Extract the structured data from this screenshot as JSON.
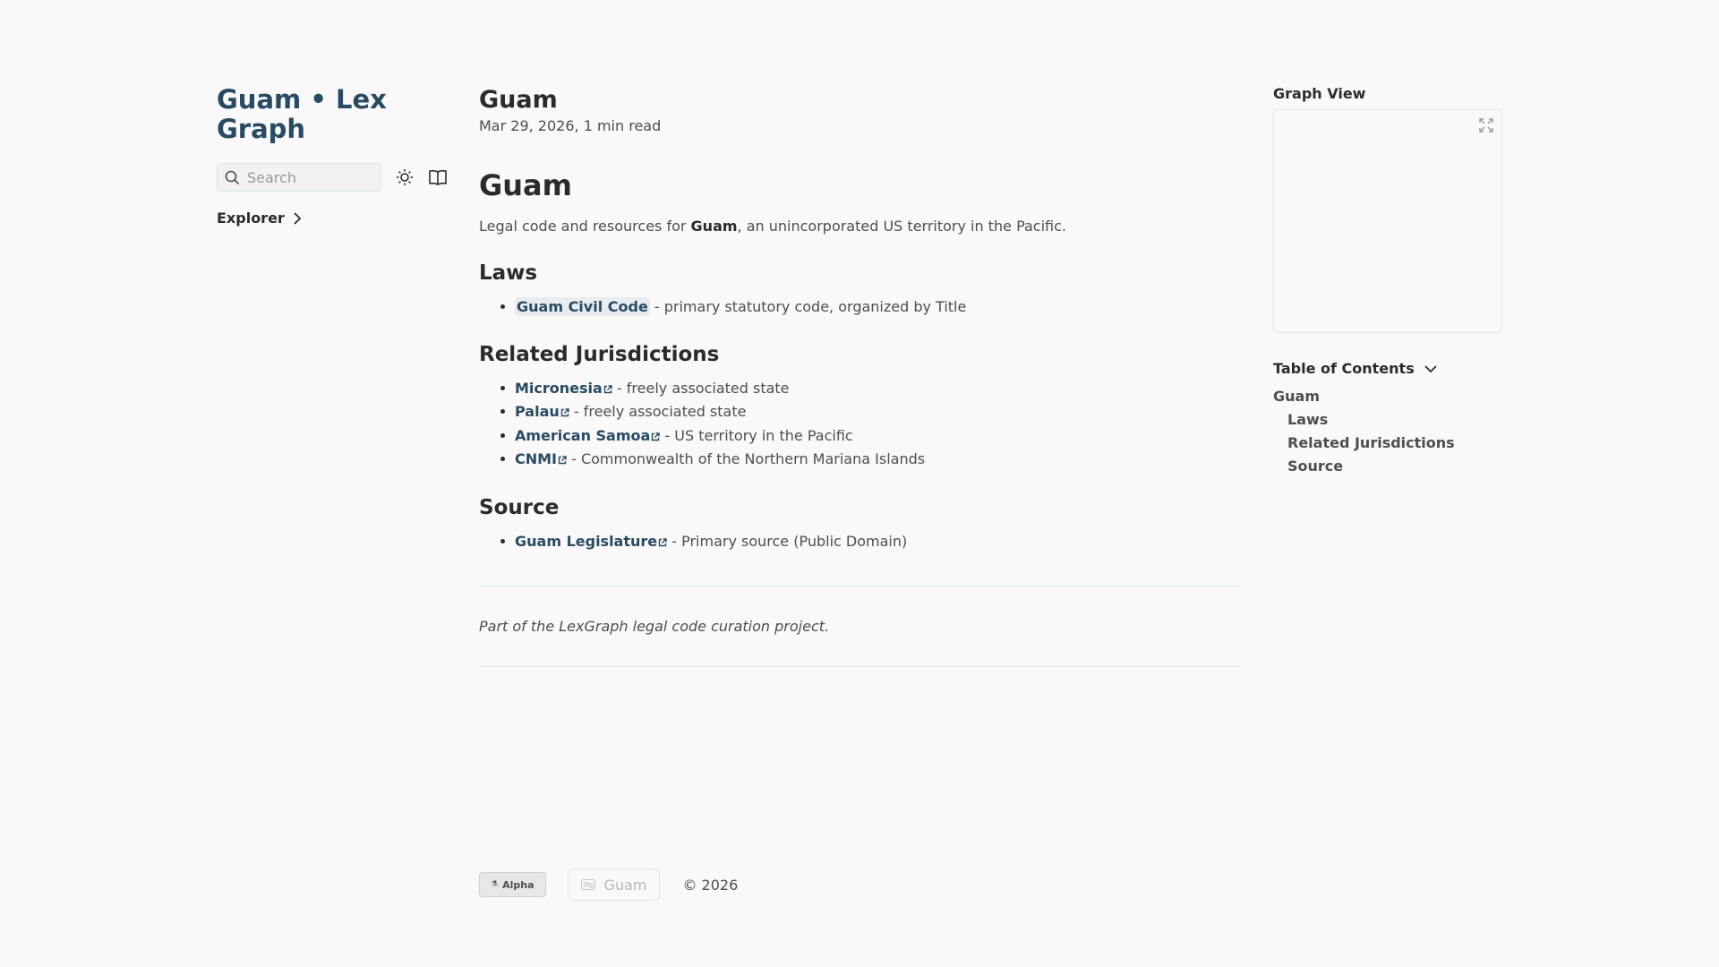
{
  "site": {
    "title": "Guam • Lex Graph"
  },
  "search": {
    "placeholder": "Search"
  },
  "explorer": {
    "label": "Explorer"
  },
  "page": {
    "title": "Guam",
    "date": "Mar 29, 2026,",
    "read_time": "1 min read",
    "heading": "Guam",
    "intro_before": "Legal code and resources for ",
    "intro_bold": "Guam",
    "intro_after": ", an unincorporated US territory in the Pacific."
  },
  "laws": {
    "heading": "Laws",
    "items": [
      {
        "link": "Guam Civil Code",
        "desc": " - primary statutory code, organized by Title"
      }
    ]
  },
  "related": {
    "heading": "Related Jurisdictions",
    "items": [
      {
        "link": "Micronesia",
        "desc": " - freely associated state"
      },
      {
        "link": "Palau",
        "desc": " - freely associated state"
      },
      {
        "link": "American Samoa",
        "desc": " - US territory in the Pacific"
      },
      {
        "link": "CNMI",
        "desc": " - Commonwealth of the Northern Mariana Islands"
      }
    ]
  },
  "source": {
    "heading": "Source",
    "items": [
      {
        "link": "Guam Legislature",
        "desc": " - Primary source (Public Domain)"
      }
    ]
  },
  "note": "Part of the LexGraph legal code curation project.",
  "graph": {
    "title": "Graph View"
  },
  "toc": {
    "title": "Table of Contents",
    "items": [
      "Guam",
      "Laws",
      "Related Jurisdictions",
      "Source"
    ]
  },
  "footer": {
    "alpha": "Alpha",
    "guam": "Guam",
    "copyright": "© 2026"
  },
  "colors": {
    "accent": "#284b63",
    "background": "#faf8f8",
    "text": "#4e4e4e",
    "heading": "#2b2b2b"
  },
  "icons": [
    "search-icon",
    "sun-icon",
    "book-icon",
    "chevron-right-icon",
    "external-link-icon",
    "expand-icon",
    "chevron-down-icon",
    "flag-icon"
  ]
}
